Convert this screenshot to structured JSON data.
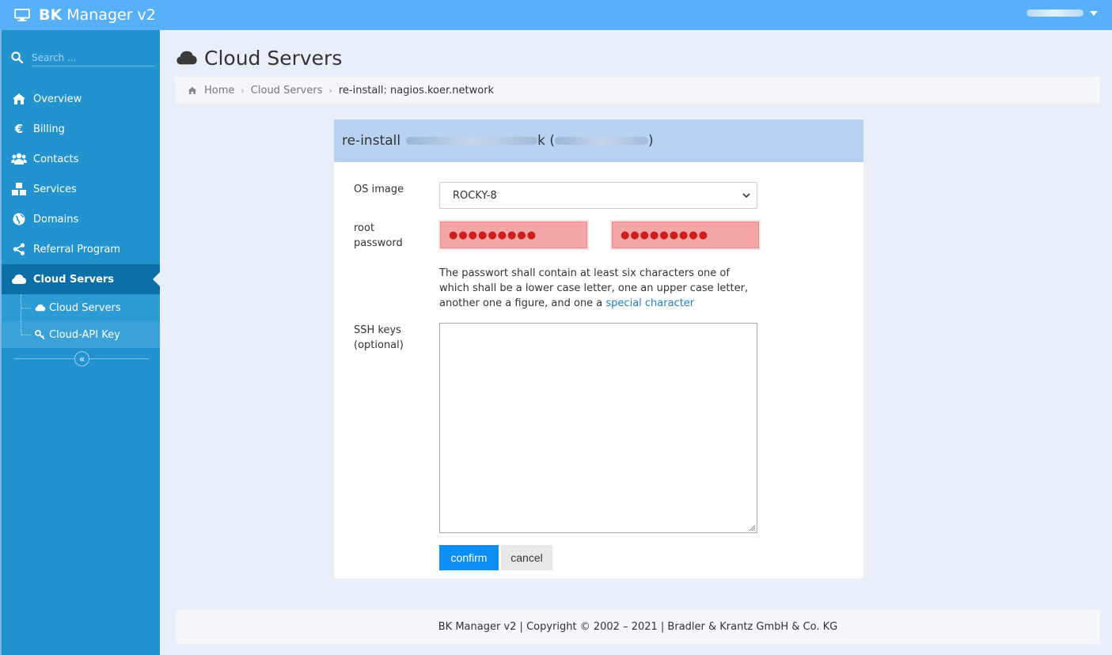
{
  "app": {
    "title_strong": "BK",
    "title_rest": "Manager v2"
  },
  "sidebar": {
    "search_placeholder": "Search ...",
    "items": [
      {
        "label": "Overview",
        "icon": "home-icon"
      },
      {
        "label": "Billing",
        "icon": "euro-icon"
      },
      {
        "label": "Contacts",
        "icon": "users-icon"
      },
      {
        "label": "Services",
        "icon": "cubes-icon"
      },
      {
        "label": "Domains",
        "icon": "globe-icon"
      },
      {
        "label": "Referral Program",
        "icon": "share-icon"
      },
      {
        "label": "Cloud Servers",
        "icon": "cloud-icon",
        "active": true
      }
    ],
    "subitems": [
      {
        "label": "Cloud Servers",
        "icon": "cloud-icon"
      },
      {
        "label": "Cloud-API Key",
        "icon": "key-icon"
      }
    ],
    "collapse_glyph": "«"
  },
  "page": {
    "title": "Cloud Servers"
  },
  "breadcrumb": {
    "home": "Home",
    "section": "Cloud Servers",
    "current": "re-install: nagios.koer.network",
    "separator": "›"
  },
  "form": {
    "heading_prefix": "re-install",
    "heading_mid_visible": "k (",
    "heading_suffix": ")",
    "os_label": "OS image",
    "os_value": "ROCKY-8",
    "password_label_1": "root",
    "password_label_2": "password",
    "password_mask_1": "●●●●●●●●●",
    "password_mask_2": "●●●●●●●●●",
    "hint_text": "The passwort shall contain at least six characters one of which shall be a lower case letter, one an upper case letter, another one a figure, and one a ",
    "hint_link": "special character",
    "ssh_label_1": "SSH keys",
    "ssh_label_2": "(optional)",
    "confirm_label": "confirm",
    "cancel_label": "cancel"
  },
  "footer": {
    "text": "BK Manager v2 | Copyright © 2002 – 2021 | Bradler & Krantz GmbH & Co. KG"
  },
  "colors": {
    "topbar": "#58b0f9",
    "sidebar": "#2393cf",
    "sidebar_active": "#0d6fa8",
    "panel_header": "#b8d3f1",
    "confirm": "#0d8ef5",
    "password_invalid": "#f4a5a5"
  }
}
